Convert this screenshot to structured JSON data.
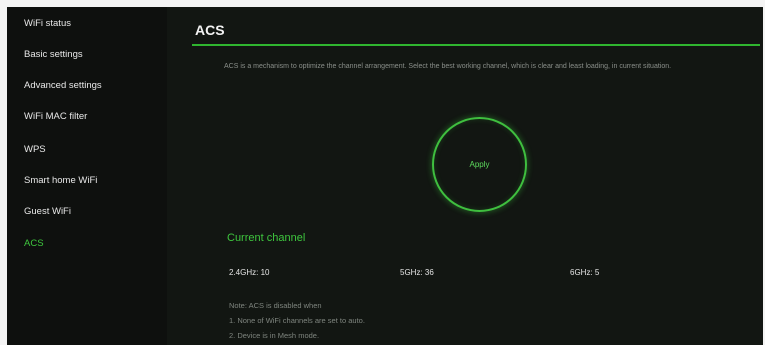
{
  "sidebar": {
    "items": [
      {
        "label": "WiFi status",
        "active": false
      },
      {
        "label": "Basic settings",
        "active": false
      },
      {
        "label": "Advanced settings",
        "active": false
      },
      {
        "label": "WiFi MAC filter",
        "active": false
      },
      {
        "label": "WPS",
        "active": false
      },
      {
        "label": "Smart home WiFi",
        "active": false
      },
      {
        "label": "Guest WiFi",
        "active": false
      },
      {
        "label": "ACS",
        "active": true
      }
    ]
  },
  "main": {
    "title": "ACS",
    "description": "ACS is a mechanism to optimize the channel arrangement. Select the best working channel, which is clear and least loading, in current situation.",
    "apply_label": "Apply",
    "current_channel": {
      "title": "Current channel",
      "channels": [
        {
          "label": "2.4GHz: 10"
        },
        {
          "label": "5GHz: 36"
        },
        {
          "label": "6GHz: 5"
        }
      ]
    },
    "note": {
      "heading": "Note: ACS is disabled when",
      "lines": [
        "1. None of WiFi channels are set to auto.",
        "2. Device is in Mesh mode."
      ]
    }
  },
  "colors": {
    "accent": "#3ec63e",
    "background": "#0b0d0b",
    "panel": "#121612"
  }
}
